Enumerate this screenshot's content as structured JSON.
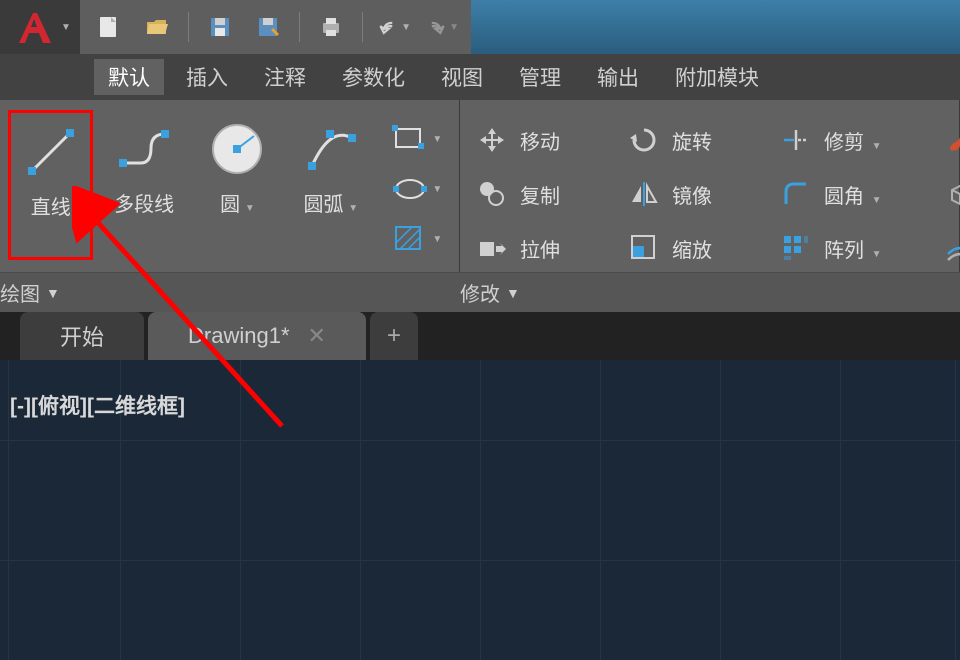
{
  "app": {
    "logo_text": "A"
  },
  "menu": {
    "items": [
      {
        "label": "默认",
        "active": true
      },
      {
        "label": "插入",
        "active": false
      },
      {
        "label": "注释",
        "active": false
      },
      {
        "label": "参数化",
        "active": false
      },
      {
        "label": "视图",
        "active": false
      },
      {
        "label": "管理",
        "active": false
      },
      {
        "label": "输出",
        "active": false
      },
      {
        "label": "附加模块",
        "active": false
      }
    ]
  },
  "draw_panel": {
    "title": "绘图",
    "tools": [
      {
        "label": "直线"
      },
      {
        "label": "多段线"
      },
      {
        "label": "圆"
      },
      {
        "label": "圆弧"
      }
    ]
  },
  "modify_panel": {
    "title": "修改",
    "items": [
      {
        "label": "移动"
      },
      {
        "label": "旋转"
      },
      {
        "label": "修剪"
      },
      {
        "label": "复制"
      },
      {
        "label": "镜像"
      },
      {
        "label": "圆角"
      },
      {
        "label": "拉伸"
      },
      {
        "label": "缩放"
      },
      {
        "label": "阵列"
      }
    ]
  },
  "tabs": {
    "start": "开始",
    "drawing": "Drawing1*"
  },
  "viewport": {
    "label": "[-][俯视][二维线框]"
  }
}
